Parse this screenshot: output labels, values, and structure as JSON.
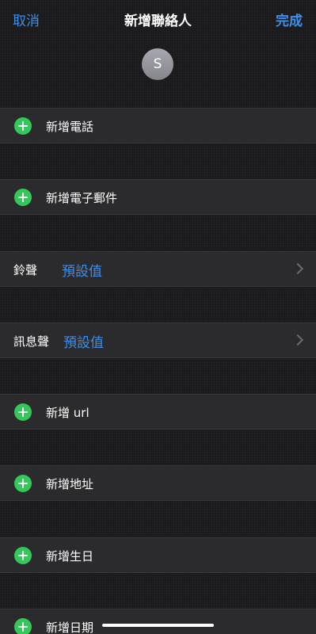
{
  "nav": {
    "cancel": "取消",
    "title": "新增聯絡人",
    "done": "完成"
  },
  "avatar": {
    "initial": "S"
  },
  "rows": {
    "add_phone": "新增電話",
    "add_email": "新增電子郵件",
    "ringtone_label": "鈴聲",
    "ringtone_value": "預設值",
    "text_tone_label": "訊息聲",
    "text_tone_value": "預設值",
    "add_url": "新增 url",
    "add_address": "新增地址",
    "add_birthday": "新增生日",
    "add_date": "新增日期"
  },
  "colors": {
    "accent": "#3d8fea",
    "add_green": "#34c759",
    "background": "#1a1a1c",
    "row_background": "#2b2b2d"
  },
  "icons": {
    "add": "plus-circle-icon",
    "disclosure": "chevron-right-icon"
  }
}
